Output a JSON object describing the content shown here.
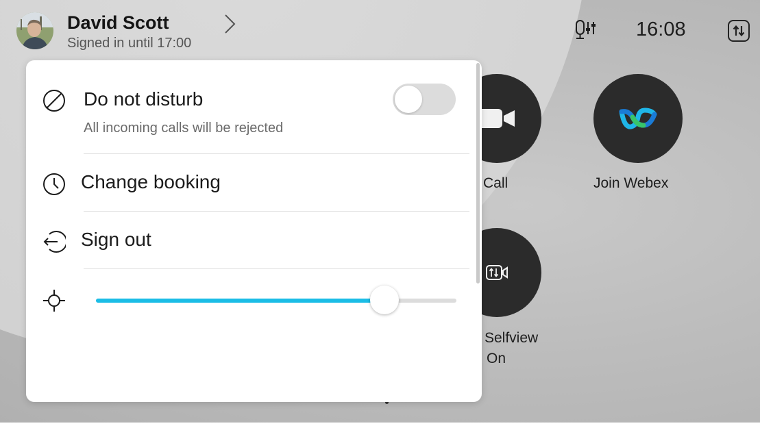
{
  "header": {
    "user_name": "David Scott",
    "user_status": "Signed in until 17:00",
    "time": "16:08",
    "icons": [
      "avatar",
      "chevron-right-icon",
      "microphone-settings-icon",
      "swap-icon"
    ]
  },
  "tiles": {
    "call_label": "Call",
    "webex_label": "Join Webex",
    "selfview_label_line1": "Selfview",
    "selfview_label_line2": "On",
    "icons": [
      "video-camera-icon",
      "webex-logo-icon",
      "selfview-icon"
    ]
  },
  "panel": {
    "dnd": {
      "label": "Do not disturb",
      "sublabel": "All incoming calls will be rejected",
      "enabled": false,
      "icon": "do-not-disturb-icon"
    },
    "booking": {
      "label": "Change booking",
      "icon": "clock-icon"
    },
    "signout": {
      "label": "Sign out",
      "icon": "sign-out-icon"
    },
    "brightness": {
      "level_fraction": 0.8,
      "icon": "brightness-icon"
    }
  },
  "colors": {
    "accent": "#1bbde6",
    "tile_dark": "#2b2b2b",
    "toggle_off": "#dcdcdc"
  }
}
